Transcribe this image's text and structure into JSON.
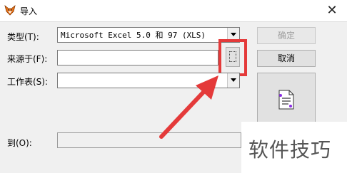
{
  "window": {
    "title": "导入",
    "close_glyph": "✕",
    "app_icon": "fox-icon"
  },
  "form": {
    "type": {
      "label": "类型(T):",
      "value": "Microsoft Excel 5.0 和 97 (XLS)"
    },
    "source": {
      "label": "来源于(F):",
      "value": ""
    },
    "sheet": {
      "label": "工作表(S):",
      "value": ""
    },
    "to": {
      "label": "到(O):",
      "value": ""
    }
  },
  "buttons": {
    "ok": "确定",
    "cancel": "取消",
    "browse_icon": "file-browse-icon",
    "import_icon": "import-settings-icon"
  },
  "annotation": {
    "highlight_color": "#e43a3a",
    "arrow_color": "#e43a3a"
  },
  "watermark": {
    "text": "软件技巧"
  }
}
